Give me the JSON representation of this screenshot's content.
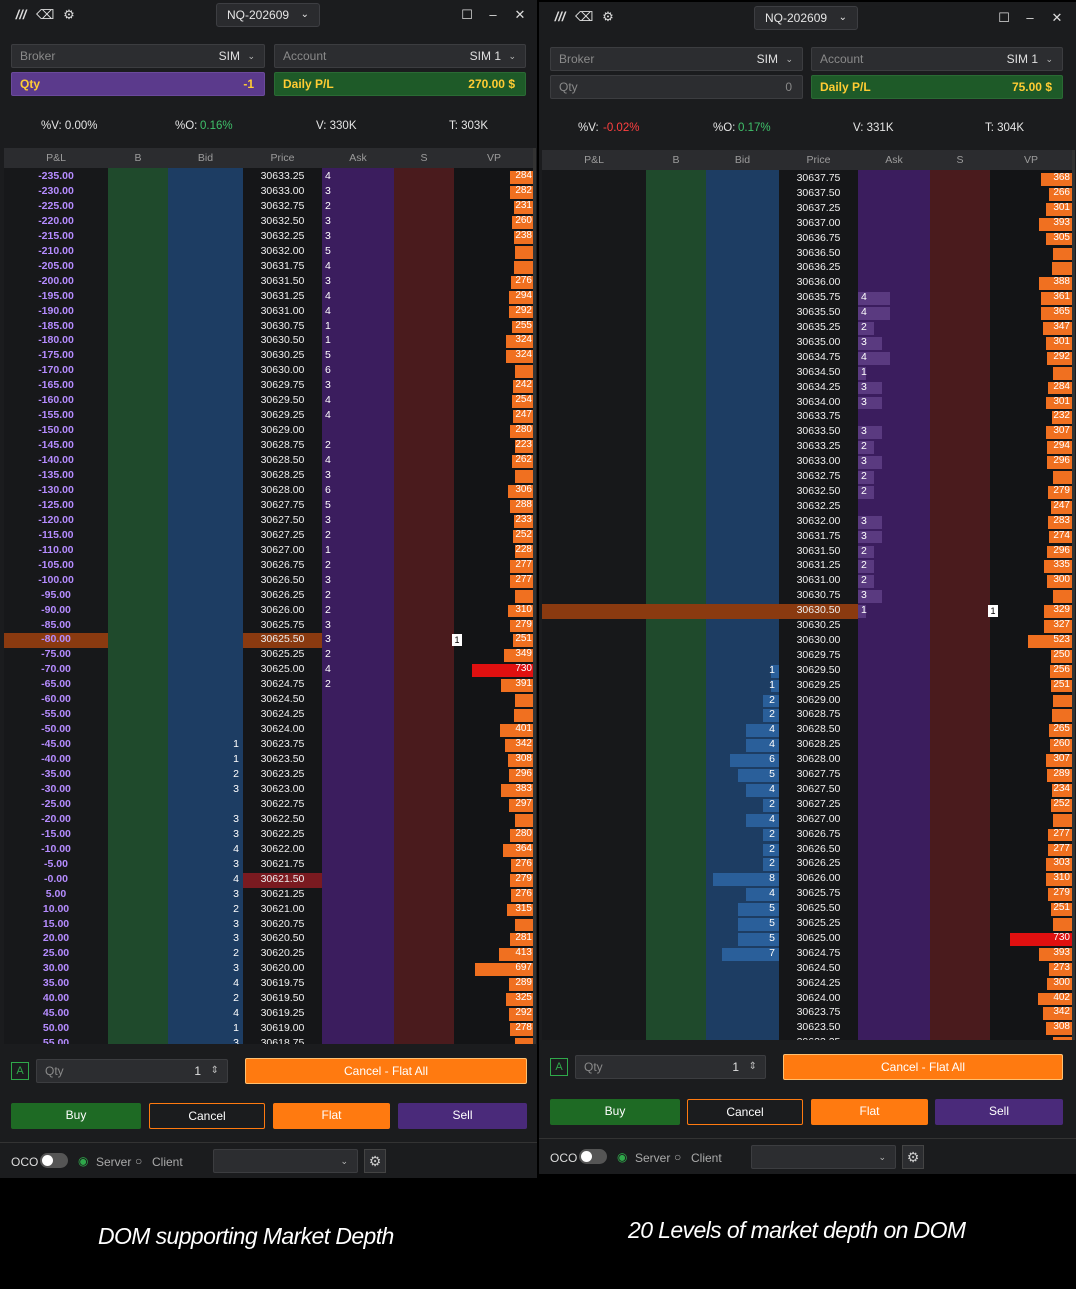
{
  "colors": {
    "bg": "#1b1c1e",
    "bidColumn": "#1d3d63",
    "askColumn": "#3b1d5e",
    "buyColumn": "#1f4a2c",
    "sellColumn": "#4a1b1d",
    "vp": "#f07020",
    "vpMax": "#e01010",
    "buy": "#1e7a2a",
    "sell": "#4a2a7a",
    "flat": "#ff7a10",
    "qtyPurple": "#5b3a8c",
    "plGreen": "#1e5a28",
    "plText": "#b58cff"
  },
  "panels": [
    {
      "symbol": "NQ-202609",
      "broker": {
        "label": "Broker",
        "value": "SIM"
      },
      "account": {
        "label": "Account",
        "value": "SIM 1"
      },
      "qty": {
        "label": "Qty",
        "value": "-1"
      },
      "daily_pl": {
        "label": "Daily P/L",
        "value": "270.00 $"
      },
      "stats": {
        "v_pct": "%V: 0.00%",
        "o_label": "%O:",
        "o_val": "0.16%",
        "vol": "V: 330K",
        "trades": "T: 303K"
      },
      "columns": [
        "P&L",
        "B",
        "Bid",
        "Price",
        "Ask",
        "S",
        "VP"
      ],
      "order_marker": "1",
      "rows": [
        {
          "pl": "-235.00",
          "price": "30633.25",
          "ask": "4",
          "vp": "284"
        },
        {
          "pl": "-230.00",
          "price": "30633.00",
          "ask": "3",
          "vp": "282"
        },
        {
          "pl": "-225.00",
          "price": "30632.75",
          "ask": "2",
          "vp": "231"
        },
        {
          "pl": "-220.00",
          "price": "30632.50",
          "ask": "3",
          "vp": "260"
        },
        {
          "pl": "-215.00",
          "price": "30632.25",
          "ask": "3",
          "vp": "238"
        },
        {
          "pl": "-210.00",
          "price": "30632.00",
          "ask": "5",
          "vp": ""
        },
        {
          "pl": "-205.00",
          "price": "30631.75",
          "ask": "4",
          "vp": ""
        },
        {
          "pl": "-200.00",
          "price": "30631.50",
          "ask": "3",
          "vp": "276"
        },
        {
          "pl": "-195.00",
          "price": "30631.25",
          "ask": "4",
          "vp": "294"
        },
        {
          "pl": "-190.00",
          "price": "30631.00",
          "ask": "4",
          "vp": "292"
        },
        {
          "pl": "-185.00",
          "price": "30630.75",
          "ask": "1",
          "vp": "255"
        },
        {
          "pl": "-180.00",
          "price": "30630.50",
          "ask": "1",
          "vp": "324"
        },
        {
          "pl": "-175.00",
          "price": "30630.25",
          "ask": "5",
          "vp": "324"
        },
        {
          "pl": "-170.00",
          "price": "30630.00",
          "ask": "6",
          "vp": ""
        },
        {
          "pl": "-165.00",
          "price": "30629.75",
          "ask": "3",
          "vp": "242"
        },
        {
          "pl": "-160.00",
          "price": "30629.50",
          "ask": "4",
          "vp": "254"
        },
        {
          "pl": "-155.00",
          "price": "30629.25",
          "ask": "4",
          "vp": "247"
        },
        {
          "pl": "-150.00",
          "price": "30629.00",
          "ask": "",
          "vp": "280"
        },
        {
          "pl": "-145.00",
          "price": "30628.75",
          "ask": "2",
          "vp": "223"
        },
        {
          "pl": "-140.00",
          "price": "30628.50",
          "ask": "4",
          "vp": "262"
        },
        {
          "pl": "-135.00",
          "price": "30628.25",
          "ask": "3",
          "vp": ""
        },
        {
          "pl": "-130.00",
          "price": "30628.00",
          "ask": "6",
          "vp": "306"
        },
        {
          "pl": "-125.00",
          "price": "30627.75",
          "ask": "5",
          "vp": "288"
        },
        {
          "pl": "-120.00",
          "price": "30627.50",
          "ask": "3",
          "vp": "233"
        },
        {
          "pl": "-115.00",
          "price": "30627.25",
          "ask": "2",
          "vp": "252"
        },
        {
          "pl": "-110.00",
          "price": "30627.00",
          "ask": "1",
          "vp": "228"
        },
        {
          "pl": "-105.00",
          "price": "30626.75",
          "ask": "2",
          "vp": "277"
        },
        {
          "pl": "-100.00",
          "price": "30626.50",
          "ask": "3",
          "vp": "277"
        },
        {
          "pl": "-95.00",
          "price": "30626.25",
          "ask": "2",
          "vp": ""
        },
        {
          "pl": "-90.00",
          "price": "30626.00",
          "ask": "2",
          "vp": "310"
        },
        {
          "pl": "-85.00",
          "price": "30625.75",
          "ask": "3",
          "vp": "279"
        },
        {
          "pl": "-80.00",
          "price": "30625.50",
          "ask": "3",
          "vp": "251"
        },
        {
          "pl": "-75.00",
          "price": "30625.25",
          "ask": "2",
          "vp": "349"
        },
        {
          "pl": "-70.00",
          "price": "30625.00",
          "ask": "4",
          "vp": "730"
        },
        {
          "pl": "-65.00",
          "price": "30624.75",
          "ask": "2",
          "vp": "391"
        },
        {
          "pl": "-60.00",
          "price": "30624.50",
          "bid": "",
          "vp": ""
        },
        {
          "pl": "-55.00",
          "price": "30624.25",
          "bid": "",
          "vp": ""
        },
        {
          "pl": "-50.00",
          "price": "30624.00",
          "bid": "",
          "vp": "401"
        },
        {
          "pl": "-45.00",
          "price": "30623.75",
          "bid": "1",
          "vp": "342"
        },
        {
          "pl": "-40.00",
          "price": "30623.50",
          "bid": "1",
          "vp": "308"
        },
        {
          "pl": "-35.00",
          "price": "30623.25",
          "bid": "2",
          "vp": "296"
        },
        {
          "pl": "-30.00",
          "price": "30623.00",
          "bid": "3",
          "vp": "383"
        },
        {
          "pl": "-25.00",
          "price": "30622.75",
          "bid": "",
          "vp": "297"
        },
        {
          "pl": "-20.00",
          "price": "30622.50",
          "bid": "3",
          "vp": ""
        },
        {
          "pl": "-15.00",
          "price": "30622.25",
          "bid": "3",
          "vp": "280"
        },
        {
          "pl": "-10.00",
          "price": "30622.00",
          "bid": "4",
          "vp": "364"
        },
        {
          "pl": "-5.00",
          "price": "30621.75",
          "bid": "3",
          "vp": "276"
        },
        {
          "pl": "-0.00",
          "price": "30621.50",
          "bid": "4",
          "vp": "279"
        },
        {
          "pl": "5.00",
          "price": "30621.25",
          "bid": "3",
          "vp": "276"
        },
        {
          "pl": "10.00",
          "price": "30621.00",
          "bid": "2",
          "vp": "315"
        },
        {
          "pl": "15.00",
          "price": "30620.75",
          "bid": "3",
          "vp": ""
        },
        {
          "pl": "20.00",
          "price": "30620.50",
          "bid": "3",
          "vp": "281"
        },
        {
          "pl": "25.00",
          "price": "30620.25",
          "bid": "2",
          "vp": "413"
        },
        {
          "pl": "30.00",
          "price": "30620.00",
          "bid": "3",
          "vp": "697"
        },
        {
          "pl": "35.00",
          "price": "30619.75",
          "bid": "4",
          "vp": "289"
        },
        {
          "pl": "40.00",
          "price": "30619.50",
          "bid": "2",
          "vp": "325"
        },
        {
          "pl": "45.00",
          "price": "30619.25",
          "bid": "4",
          "vp": "292"
        },
        {
          "pl": "50.00",
          "price": "30619.00",
          "bid": "1",
          "vp": "278"
        },
        {
          "pl": "55.00",
          "price": "30618.75",
          "bid": "3",
          "vp": ""
        }
      ],
      "bottom": {
        "a_label": "A",
        "qty_placeholder": "Qty",
        "qty_value": "1",
        "cancel_flat_all": "Cancel - Flat All",
        "buy": "Buy",
        "cancel": "Cancel",
        "flat": "Flat",
        "sell": "Sell",
        "oco": "OCO",
        "server": "Server",
        "client": "Client"
      }
    },
    {
      "symbol": "NQ-202609",
      "broker": {
        "label": "Broker",
        "value": "SIM"
      },
      "account": {
        "label": "Account",
        "value": "SIM 1"
      },
      "qty": {
        "label": "Qty",
        "value": "0"
      },
      "daily_pl": {
        "label": "Daily P/L",
        "value": "75.00 $"
      },
      "stats": {
        "v_pct": "%V:",
        "v_val": "-0.02%",
        "o_label": "%O:",
        "o_val": "0.17%",
        "vol": "V: 331K",
        "trades": "T: 304K"
      },
      "columns": [
        "P&L",
        "B",
        "Bid",
        "Price",
        "Ask",
        "S",
        "VP"
      ],
      "order_marker": "1",
      "rows": [
        {
          "price": "30637.75",
          "ask": "",
          "vp": "368"
        },
        {
          "price": "30637.50",
          "ask": "",
          "vp": "266"
        },
        {
          "price": "30637.25",
          "ask": "",
          "vp": "301"
        },
        {
          "price": "30637.00",
          "ask": "",
          "vp": "393"
        },
        {
          "price": "30636.75",
          "ask": "",
          "vp": "305"
        },
        {
          "price": "30636.50",
          "ask": "",
          "vp": ""
        },
        {
          "price": "30636.25",
          "ask": "",
          "vp": ""
        },
        {
          "price": "30636.00",
          "ask": "",
          "vp": "388"
        },
        {
          "price": "30635.75",
          "ask": "4",
          "vp": "361"
        },
        {
          "price": "30635.50",
          "ask": "4",
          "vp": "365"
        },
        {
          "price": "30635.25",
          "ask": "2",
          "vp": "347"
        },
        {
          "price": "30635.00",
          "ask": "3",
          "vp": "301"
        },
        {
          "price": "30634.75",
          "ask": "4",
          "vp": "292"
        },
        {
          "price": "30634.50",
          "ask": "1",
          "vp": ""
        },
        {
          "price": "30634.25",
          "ask": "3",
          "vp": "284"
        },
        {
          "price": "30634.00",
          "ask": "3",
          "vp": "301"
        },
        {
          "price": "30633.75",
          "ask": "",
          "vp": "232"
        },
        {
          "price": "30633.50",
          "ask": "3",
          "vp": "307"
        },
        {
          "price": "30633.25",
          "ask": "2",
          "vp": "294"
        },
        {
          "price": "30633.00",
          "ask": "3",
          "vp": "296"
        },
        {
          "price": "30632.75",
          "ask": "2",
          "vp": ""
        },
        {
          "price": "30632.50",
          "ask": "2",
          "vp": "279"
        },
        {
          "price": "30632.25",
          "ask": "",
          "vp": "247"
        },
        {
          "price": "30632.00",
          "ask": "3",
          "vp": "283"
        },
        {
          "price": "30631.75",
          "ask": "3",
          "vp": "274"
        },
        {
          "price": "30631.50",
          "ask": "2",
          "vp": "296"
        },
        {
          "price": "30631.25",
          "ask": "2",
          "vp": "335"
        },
        {
          "price": "30631.00",
          "ask": "2",
          "vp": "300"
        },
        {
          "price": "30630.75",
          "ask": "3",
          "vp": ""
        },
        {
          "price": "30630.50",
          "ask": "1",
          "vp": "329"
        },
        {
          "price": "30630.25",
          "ask": "",
          "vp": "327"
        },
        {
          "price": "30630.00",
          "bid": "",
          "vp": "523"
        },
        {
          "price": "30629.75",
          "bid": "",
          "vp": "250"
        },
        {
          "price": "30629.50",
          "bid": "1",
          "vp": "256"
        },
        {
          "price": "30629.25",
          "bid": "1",
          "vp": "251"
        },
        {
          "price": "30629.00",
          "bid": "2",
          "vp": ""
        },
        {
          "price": "30628.75",
          "bid": "2",
          "vp": ""
        },
        {
          "price": "30628.50",
          "bid": "4",
          "vp": "265"
        },
        {
          "price": "30628.25",
          "bid": "4",
          "vp": "260"
        },
        {
          "price": "30628.00",
          "bid": "6",
          "vp": "307"
        },
        {
          "price": "30627.75",
          "bid": "5",
          "vp": "289"
        },
        {
          "price": "30627.50",
          "bid": "4",
          "vp": "234"
        },
        {
          "price": "30627.25",
          "bid": "2",
          "vp": "252"
        },
        {
          "price": "30627.00",
          "bid": "4",
          "vp": ""
        },
        {
          "price": "30626.75",
          "bid": "2",
          "vp": "277"
        },
        {
          "price": "30626.50",
          "bid": "2",
          "vp": "277"
        },
        {
          "price": "30626.25",
          "bid": "2",
          "vp": "303"
        },
        {
          "price": "30626.00",
          "bid": "8",
          "vp": "310"
        },
        {
          "price": "30625.75",
          "bid": "4",
          "vp": "279"
        },
        {
          "price": "30625.50",
          "bid": "5",
          "vp": "251"
        },
        {
          "price": "30625.25",
          "bid": "5",
          "vp": ""
        },
        {
          "price": "30625.00",
          "bid": "5",
          "vp": "730"
        },
        {
          "price": "30624.75",
          "bid": "7",
          "vp": "393"
        },
        {
          "price": "30624.50",
          "bid": "",
          "vp": "273"
        },
        {
          "price": "30624.25",
          "bid": "",
          "vp": "300"
        },
        {
          "price": "30624.00",
          "bid": "",
          "vp": "402"
        },
        {
          "price": "30623.75",
          "bid": "",
          "vp": "342"
        },
        {
          "price": "30623.50",
          "bid": "",
          "vp": "308"
        },
        {
          "price": "30623.25",
          "bid": "",
          "vp": ""
        }
      ],
      "bottom": {
        "a_label": "A",
        "qty_placeholder": "Qty",
        "qty_value": "1",
        "cancel_flat_all": "Cancel - Flat All",
        "buy": "Buy",
        "cancel": "Cancel",
        "flat": "Flat",
        "sell": "Sell",
        "oco": "OCO",
        "server": "Server",
        "client": "Client"
      }
    }
  ],
  "captions": [
    "DOM supporting Market Depth",
    "20 Levels of market depth on DOM"
  ]
}
